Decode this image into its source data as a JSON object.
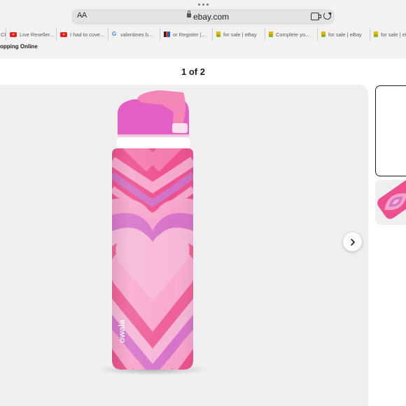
{
  "browser": {
    "address": {
      "text_size_label": "AA",
      "domain": "ebay.com"
    },
    "tabs": [
      {
        "label": "Ck",
        "favicon": ""
      },
      {
        "label": "Live Reseller...",
        "favicon": "youtube-icon"
      },
      {
        "label": "I had to cove...",
        "favicon": "youtube-icon"
      },
      {
        "label": "valentines b...",
        "favicon": "google-icon"
      },
      {
        "label": "or Register |...",
        "favicon": "ebay-register-icon"
      },
      {
        "label": "for sale | eBay",
        "favicon": "ebay-icon"
      },
      {
        "label": "Complete yo...",
        "favicon": "ebay-icon"
      },
      {
        "label": "for sale | eBay",
        "favicon": "ebay-icon"
      },
      {
        "label": "for sale | eBay",
        "favicon": "ebay-icon"
      }
    ],
    "bookmark_text": "opping Online"
  },
  "gallery": {
    "counter": "1 of 2",
    "main_image": "pink-heart-water-bottle",
    "brand_on_bottle": "owala",
    "next_icon": "chevron-right-icon"
  }
}
